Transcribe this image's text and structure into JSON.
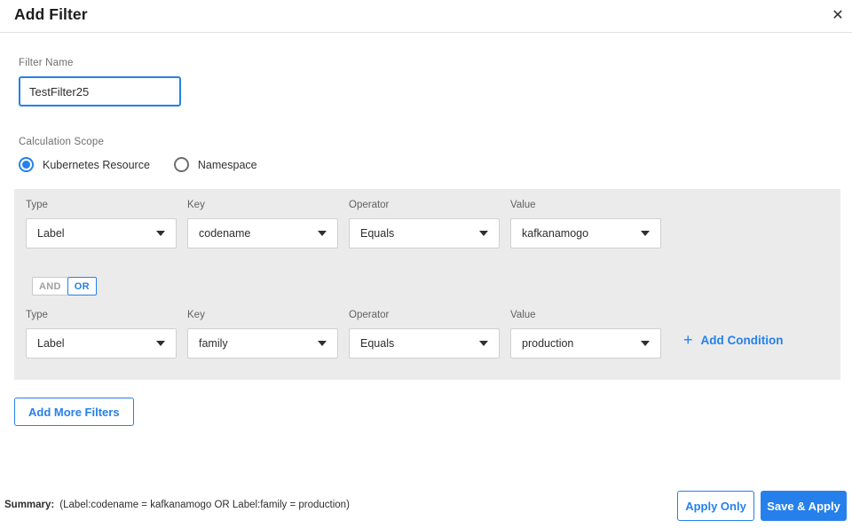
{
  "dialog": {
    "title": "Add Filter"
  },
  "icons": {
    "close": "✕",
    "add_plus": "+"
  },
  "filter_name": {
    "label": "Filter Name",
    "value": "TestFilter25"
  },
  "calculation_scope": {
    "label": "Calculation Scope",
    "options": [
      {
        "label": "Kubernetes Resource",
        "selected": true
      },
      {
        "label": "Namespace",
        "selected": false
      }
    ]
  },
  "conditions": {
    "column_labels": {
      "type": "Type",
      "key": "Key",
      "operator": "Operator",
      "value": "Value"
    },
    "rows": [
      {
        "type": "Label",
        "key": "codename",
        "operator": "Equals",
        "value": "kafkanamogo"
      },
      {
        "type": "Label",
        "key": "family",
        "operator": "Equals",
        "value": "production"
      }
    ],
    "join_toggle": {
      "and_label": "AND",
      "or_label": "OR",
      "selected": "OR"
    },
    "add_condition_label": "Add Condition"
  },
  "buttons": {
    "add_more_filters": "Add More Filters",
    "apply_only": "Apply Only",
    "save_apply": "Save & Apply"
  },
  "summary": {
    "label": "Summary:",
    "text": "(Label:codename = kafkanamogo OR Label:family = production)"
  },
  "colors": {
    "accent_blue": "#2680eb",
    "panel_gray": "#ebebeb"
  }
}
